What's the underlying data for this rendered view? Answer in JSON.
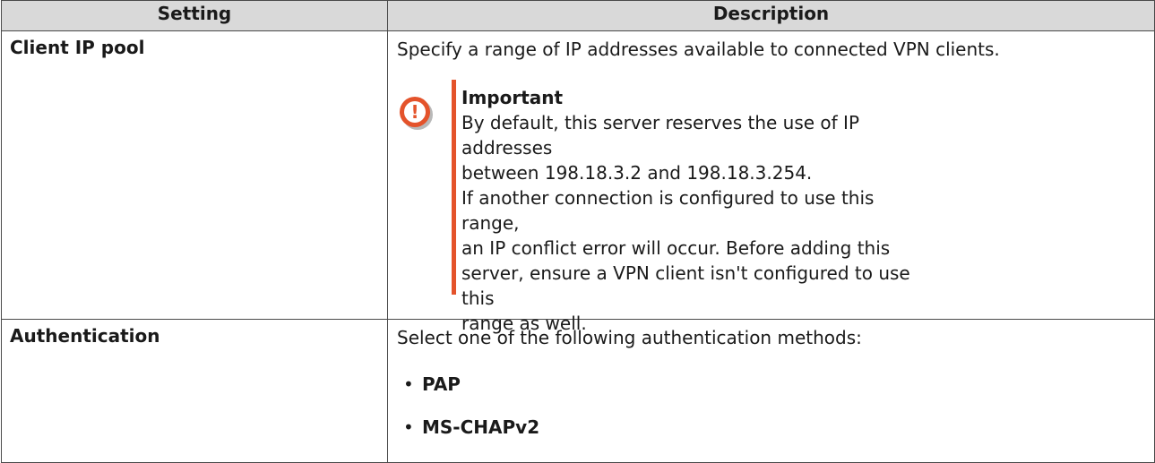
{
  "table": {
    "headers": [
      "Setting",
      "Description"
    ],
    "rows": [
      {
        "setting": "Client IP pool",
        "description": "Specify a range of IP addresses available to connected VPN clients.",
        "note": {
          "icon": "important-icon",
          "title": "Important",
          "lines": [
            "By default, this server reserves the use of IP addresses",
            "between 198.18.3.2 and 198.18.3.254.",
            "If another connection is configured to use this range,",
            "an IP conflict error will occur. Before adding this",
            "server, ensure a VPN client isn't configured to use this",
            "range as well."
          ]
        }
      },
      {
        "setting": "Authentication",
        "description": "Select one of the following authentication methods:",
        "options": [
          "PAP",
          "MS-CHAPv2"
        ]
      }
    ]
  },
  "colors": {
    "header_bg": "#d9d9d9",
    "accent": "#e4532b",
    "border": "#4a4a4a"
  }
}
